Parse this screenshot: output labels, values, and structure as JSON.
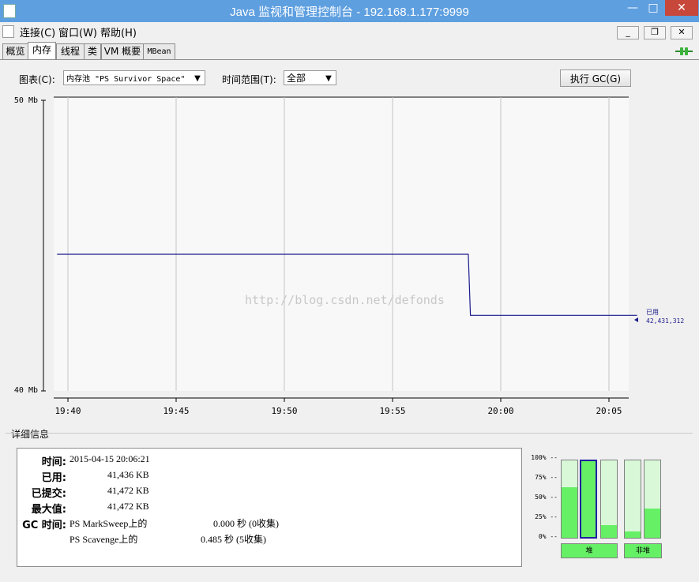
{
  "window": {
    "title": "Java 监视和管理控制台 - 192.168.1.177:9999",
    "min": "—",
    "max": "□",
    "close": "✕"
  },
  "menu": [
    "连接(C)",
    "窗口(W)",
    "帮助(H)"
  ],
  "mdi_controls": {
    "min": "_",
    "restore": "❐",
    "close": "✕"
  },
  "tabs": [
    "概览",
    "内存",
    "线程",
    "类",
    "VM 概要",
    "MBean"
  ],
  "active_tab": "内存",
  "toolbar": {
    "chart_label": "图表(C):",
    "chart_value": "内存池 \"PS Survivor Space\"",
    "range_label": "时间范围(T):",
    "range_value": "全部",
    "gc_button": "执行 GC(G)"
  },
  "watermark": "http://blog.csdn.net/defonds",
  "chart_data": {
    "type": "line",
    "ylim": [
      40,
      50
    ],
    "y_tick_labels": [
      "50 Mb",
      "40 Mb"
    ],
    "x_ticks": [
      "19:40",
      "19:45",
      "19:50",
      "19:55",
      "20:00",
      "20:05"
    ],
    "series": [
      {
        "name": "已用",
        "x": [
          "19:39.5",
          "19:58.5",
          "19:58.6",
          "20:06.3"
        ],
        "y": [
          44.7,
          44.7,
          42.6,
          42.6
        ],
        "color": "#1a1a8c"
      }
    ],
    "current_label": "已用",
    "current_value": "42,431,312",
    "grid": true
  },
  "details": {
    "section_label": "详细信息",
    "time_key": "时间:",
    "time_value": "2015-04-15 20:06:21",
    "used_key": "已用:",
    "used_value": "41,436 KB",
    "committed_key": "已提交:",
    "committed_value": "41,472 KB",
    "max_key": "最大值:",
    "max_value": "41,472 KB",
    "gc_key": "GC 时间:",
    "gc_rows": [
      {
        "name": "PS MarkSweep上的",
        "value": "0.000 秒 (0收集)"
      },
      {
        "name": "PS Scavenge上的",
        "value": "0.485 秒 (5收集)"
      }
    ]
  },
  "usage_bars": {
    "pct_labels": [
      "100% --",
      "75% --",
      "50% --",
      "25% --",
      "0% --"
    ],
    "heap_levels": [
      0.65,
      1.0,
      0.16
    ],
    "nonheap_levels": [
      0.08,
      0.38
    ],
    "heap_label": "堆",
    "nonheap_label": "非堆"
  }
}
